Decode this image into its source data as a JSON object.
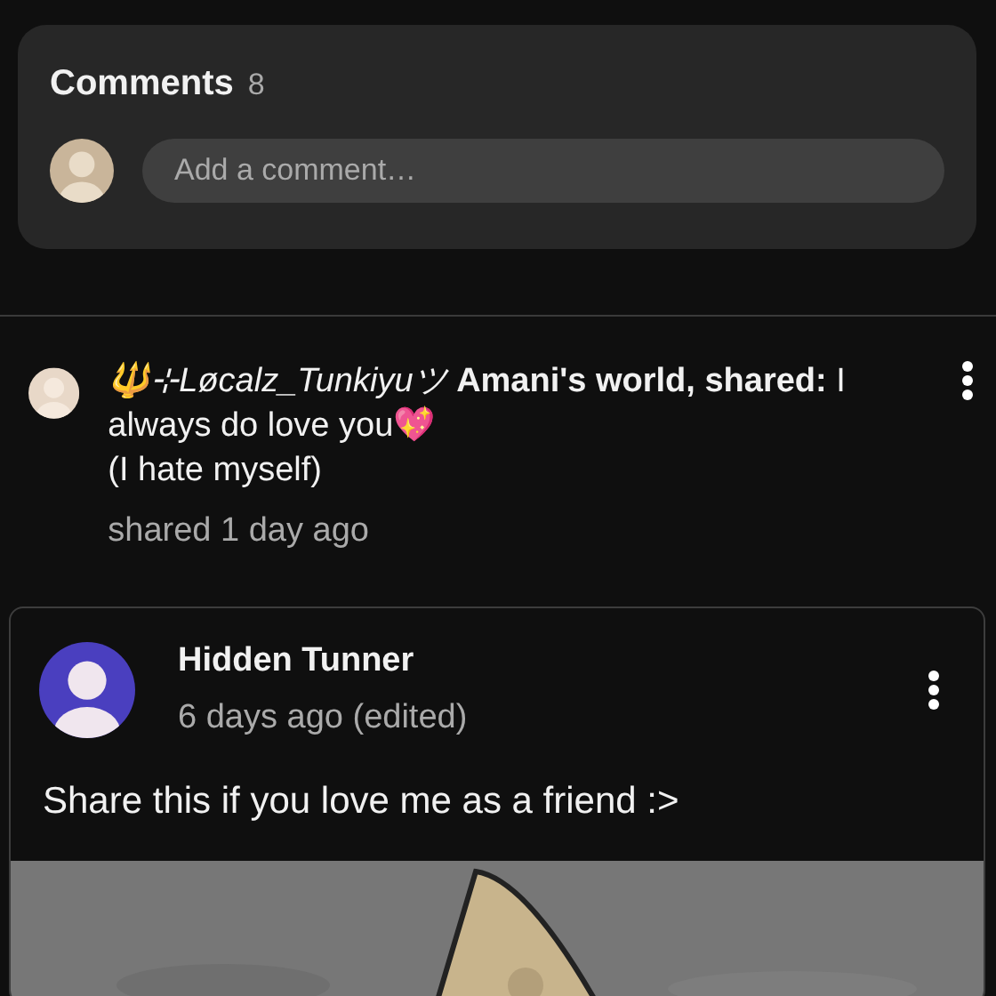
{
  "comments": {
    "title": "Comments",
    "count": "8",
    "input": {
      "placeholder": "Add a comment…"
    }
  },
  "share": {
    "header": "*🔱⊹Løcalz_Tunkiyuツ* **Amani's world,  shared:** I always do love you💖",
    "line_2": "(I hate myself)",
    "time": "shared 1 day ago"
  },
  "post": {
    "author": "Hidden Tunner",
    "time": "6 days ago (edited)",
    "text": "Share this if you love me as a friend :>"
  }
}
